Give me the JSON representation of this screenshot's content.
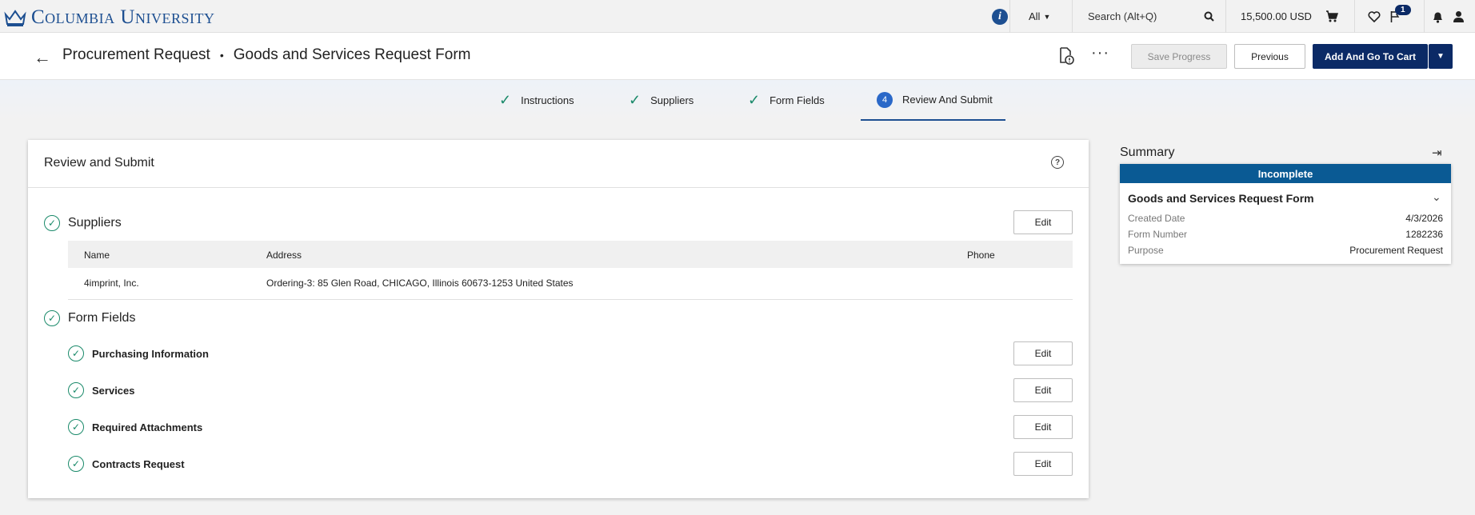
{
  "topbar": {
    "logo_text": "Columbia University",
    "filter_label": "All",
    "search_placeholder": "Search (Alt+Q)",
    "cart_total": "15,500.00 USD",
    "flag_badge": "1"
  },
  "header": {
    "title": "Procurement Request",
    "subtitle": "Goods and Services Request Form",
    "save_label": "Save Progress",
    "previous_label": "Previous",
    "add_to_cart_label": "Add And Go To Cart"
  },
  "stepper": {
    "steps": [
      {
        "label": "Instructions",
        "state": "done"
      },
      {
        "label": "Suppliers",
        "state": "done"
      },
      {
        "label": "Form Fields",
        "state": "done"
      },
      {
        "label": "Review And Submit",
        "state": "active",
        "number": "4"
      }
    ]
  },
  "review": {
    "title": "Review and Submit",
    "edit_label": "Edit",
    "suppliers_title": "Suppliers",
    "columns": [
      "Name",
      "Address",
      "Phone"
    ],
    "rows": [
      {
        "name": "4imprint, Inc.",
        "address": "Ordering-3: 85 Glen Road, CHICAGO, Illinois 60673-1253 United States",
        "phone": ""
      }
    ],
    "form_fields_title": "Form Fields",
    "form_sections": [
      "Purchasing Information",
      "Services",
      "Required Attachments",
      "Contracts Request"
    ]
  },
  "summary": {
    "label": "Summary",
    "status": "Incomplete",
    "form_title": "Goods and Services Request Form",
    "rows": [
      {
        "label": "Created Date",
        "value": "4/3/2026"
      },
      {
        "label": "Form Number",
        "value": "1282236"
      },
      {
        "label": "Purpose",
        "value": "Procurement Request"
      }
    ]
  },
  "colors": {
    "brand": "#1d4f91",
    "primary_button": "#0b2a66",
    "status_bar": "#0a5a94",
    "success": "#1a8a6a"
  }
}
